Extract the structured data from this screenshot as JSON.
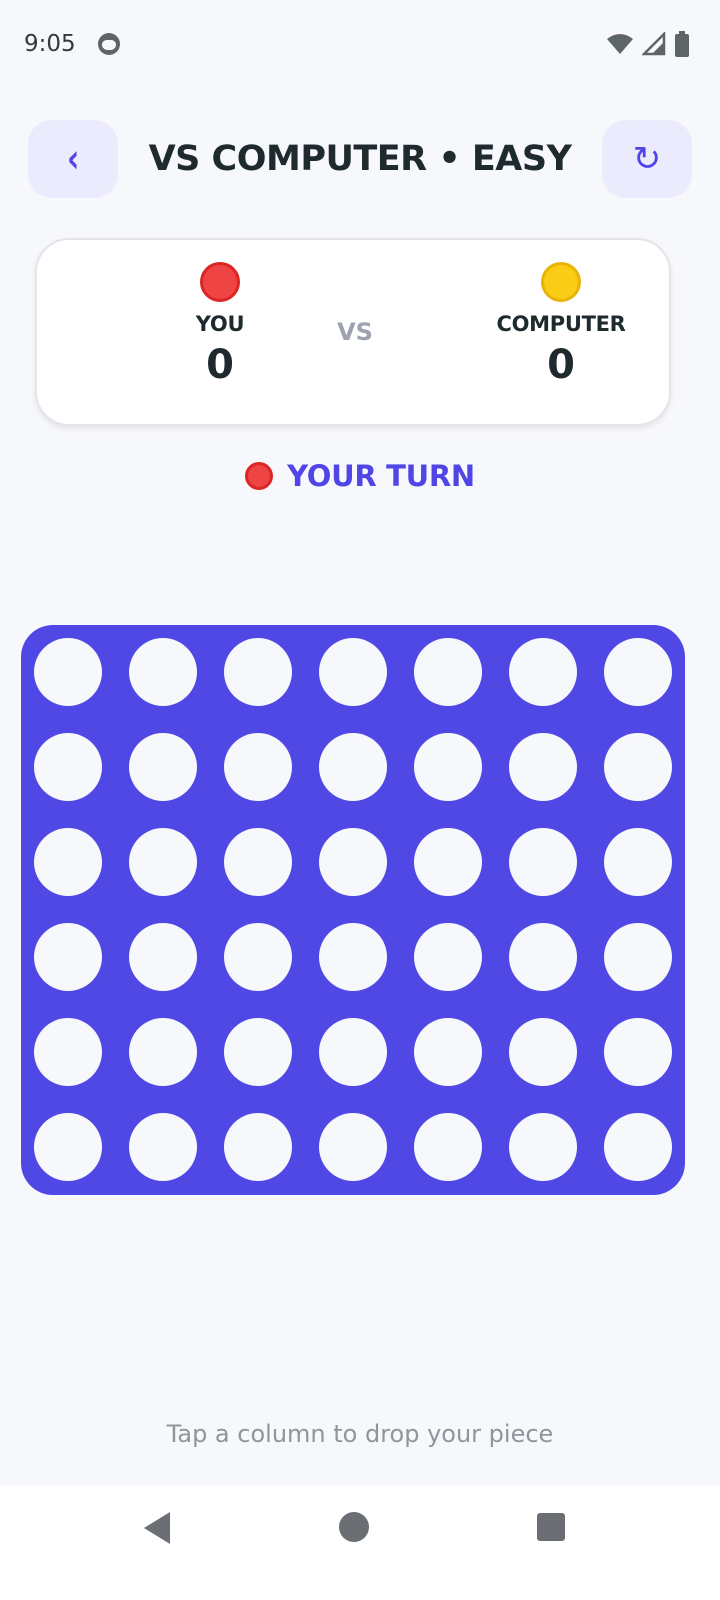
{
  "status_bar": {
    "time": "9:05"
  },
  "header": {
    "title": "VS COMPUTER • EASY",
    "back_icon": "‹",
    "reset_icon": "↻"
  },
  "scoreboard": {
    "player1": {
      "name": "YOU",
      "score": "0",
      "color": "#ef4444"
    },
    "vs": "VS",
    "player2": {
      "name": "COMPUTER",
      "score": "0",
      "color": "#facc15"
    }
  },
  "turn": {
    "label": "YOUR TURN",
    "color": "#ef4444"
  },
  "board": {
    "rows": 6,
    "columns": 7,
    "cells": [
      [
        "empty",
        "empty",
        "empty",
        "empty",
        "empty",
        "empty",
        "empty"
      ],
      [
        "empty",
        "empty",
        "empty",
        "empty",
        "empty",
        "empty",
        "empty"
      ],
      [
        "empty",
        "empty",
        "empty",
        "empty",
        "empty",
        "empty",
        "empty"
      ],
      [
        "empty",
        "empty",
        "empty",
        "empty",
        "empty",
        "empty",
        "empty"
      ],
      [
        "empty",
        "empty",
        "empty",
        "empty",
        "empty",
        "empty",
        "empty"
      ],
      [
        "empty",
        "empty",
        "empty",
        "empty",
        "empty",
        "empty",
        "empty"
      ]
    ],
    "board_color": "#5048e5"
  },
  "hint": "Tap a column to drop your piece"
}
